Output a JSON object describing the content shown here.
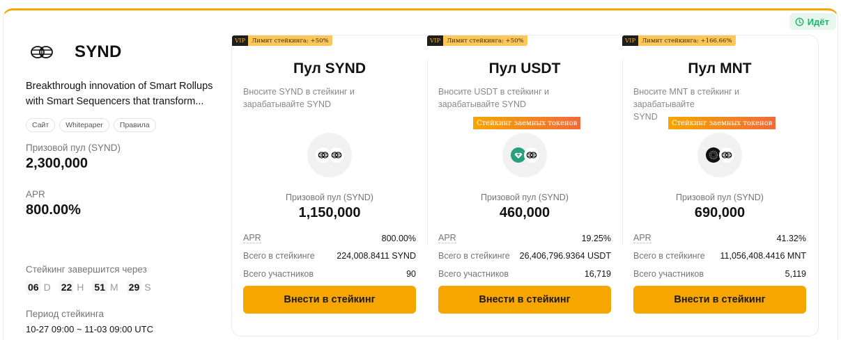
{
  "status": {
    "label": "Идёт",
    "color": "#20b26c"
  },
  "accent": "#f7a600",
  "project": {
    "name": "SYND",
    "description_line1": "Breakthrough innovation of Smart Rollups",
    "description_line2": "with Smart Sequencers that transform...",
    "links": [
      "Сайт",
      "Whitepaper",
      "Правила"
    ],
    "prize_pool_label": "Призовой пул (SYND)",
    "prize_pool_value": "2,300,000",
    "apr_label": "APR",
    "apr_value": "800.00%",
    "countdown_label": "Стейкинг завершится через",
    "countdown": {
      "days": "06",
      "days_unit": "D",
      "hours": "22",
      "hours_unit": "H",
      "minutes": "51",
      "minutes_unit": "M",
      "seconds": "29",
      "seconds_unit": "S"
    },
    "period_label": "Период стейкинга",
    "period_value": "10-27 09:00 ~ 11-03 09:00 UTC"
  },
  "pools": [
    {
      "vip": "VIP",
      "limit": "Лимит стейкинга: +50%",
      "title": "Пул SYND",
      "subtitle_line1": "Вносите SYND в стейкинг и",
      "subtitle_line2": "зарабатывайте SYND",
      "borrow_tag": "",
      "tokens": [
        "synd-icon",
        "synd-icon"
      ],
      "prize_label": "Призовой пул (SYND)",
      "prize_value": "1,150,000",
      "apr_label": "APR",
      "apr_value": "800.00%",
      "total_label": "Всего в стейкинге",
      "total_value": "224,008.8411 SYND",
      "participants_label": "Всего участников",
      "participants_value": "90",
      "button": "Внести в стейкинг"
    },
    {
      "vip": "VIP",
      "limit": "Лимит стейкинга: +50%",
      "title": "Пул USDT",
      "subtitle_line1": "Вносите USDT в стейкинг и",
      "subtitle_line2": "зарабатывайте SYND",
      "borrow_tag": "Стейкинг заемных токенов",
      "tokens": [
        "usdt-icon",
        "synd-icon"
      ],
      "prize_label": "Призовой пул (SYND)",
      "prize_value": "460,000",
      "apr_label": "APR",
      "apr_value": "19.25%",
      "total_label": "Всего в стейкинге",
      "total_value": "26,406,796.9364 USDT",
      "participants_label": "Всего участников",
      "participants_value": "16,719",
      "button": "Внести в стейкинг"
    },
    {
      "vip": "VIP",
      "limit": "Лимит стейкинга: +166.66%",
      "title": "Пул MNT",
      "subtitle_line1": "Вносите MNT в стейкинг и зарабатывайте",
      "subtitle_line2": "SYND",
      "borrow_tag": "Стейкинг заемных токенов",
      "tokens": [
        "mnt-icon",
        "synd-icon"
      ],
      "prize_label": "Призовой пул (SYND)",
      "prize_value": "690,000",
      "apr_label": "APR",
      "apr_value": "41.32%",
      "total_label": "Всего в стейкинге",
      "total_value": "11,056,408.4416 MNT",
      "participants_label": "Всего участников",
      "participants_value": "5,119",
      "button": "Внести в стейкинг"
    }
  ]
}
